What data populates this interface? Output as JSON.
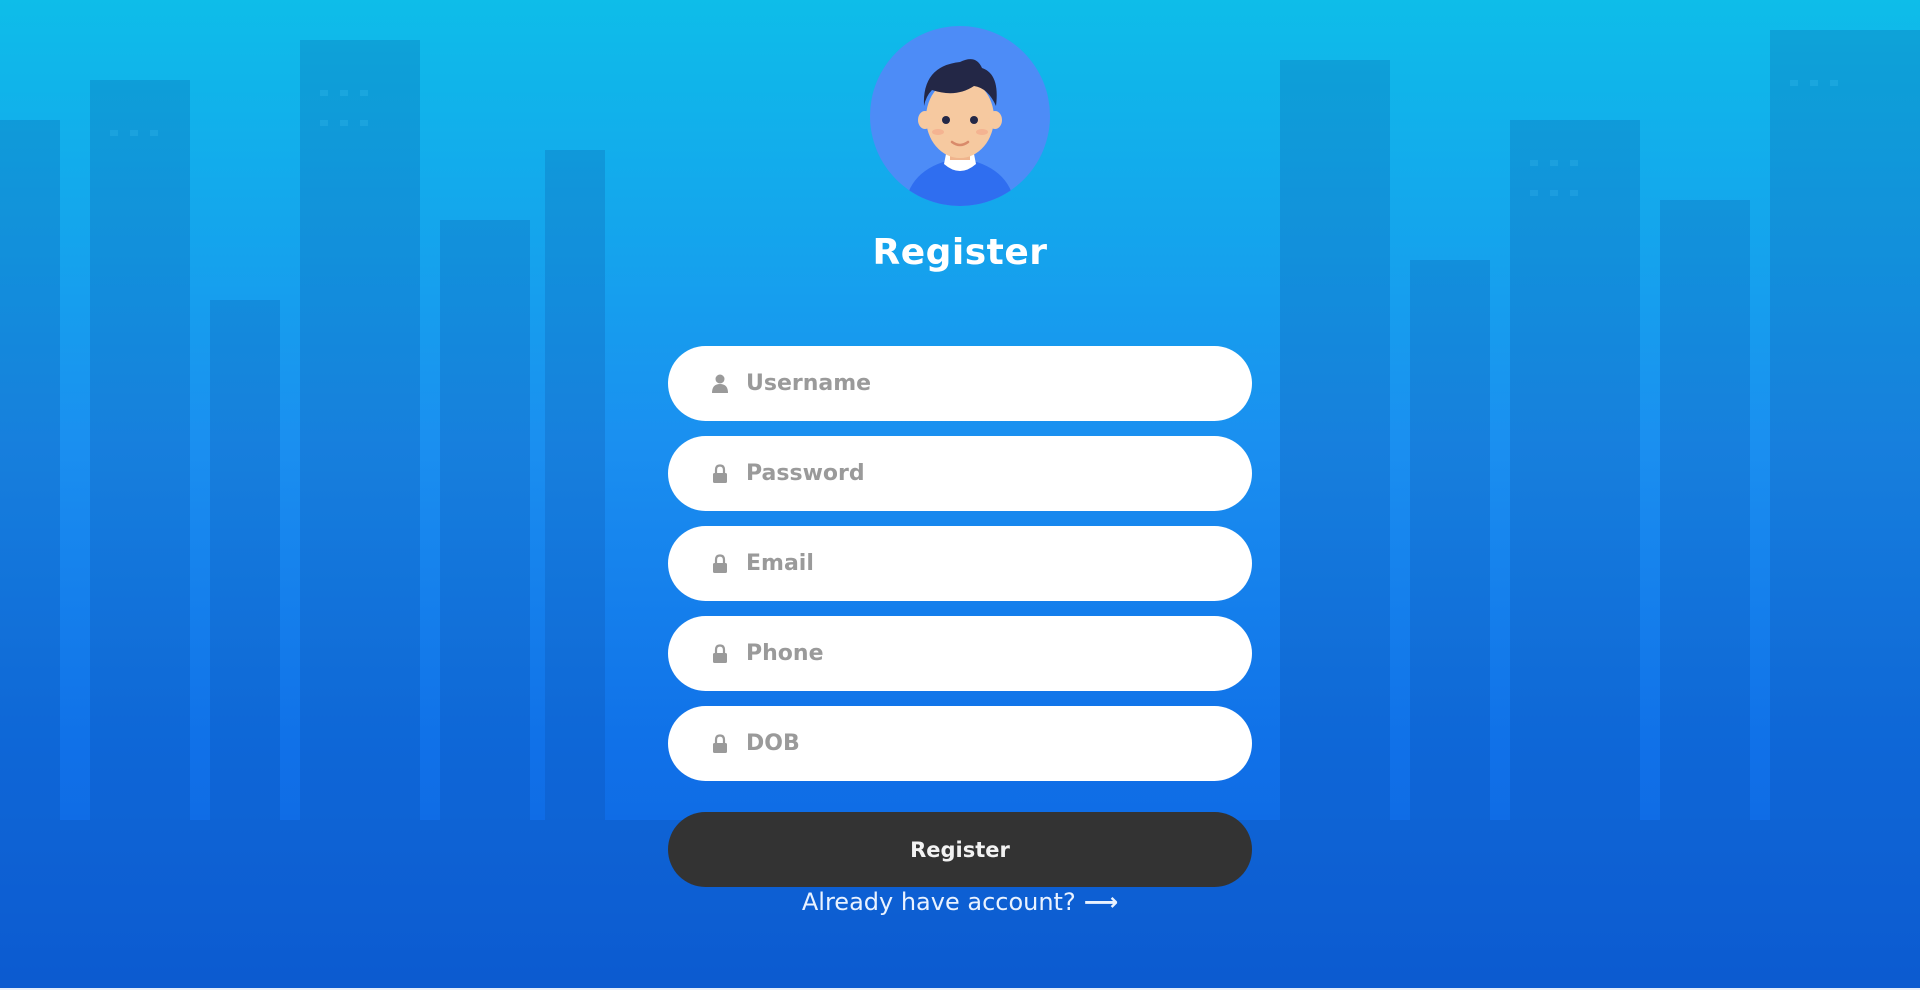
{
  "page": {
    "title": "Register"
  },
  "form": {
    "fields": [
      {
        "placeholder": "Username",
        "icon": "user-icon"
      },
      {
        "placeholder": "Password",
        "icon": "lock-icon"
      },
      {
        "placeholder": "Email",
        "icon": "lock-icon"
      },
      {
        "placeholder": "Phone",
        "icon": "lock-icon"
      },
      {
        "placeholder": "DOB",
        "icon": "lock-icon"
      }
    ],
    "submit_label": "Register",
    "login_link_text": "Already have account?",
    "login_link_arrow": "⟶"
  },
  "colors": {
    "background_top": "#0ebde9",
    "background_bottom": "#0d62e0",
    "field_bg": "#ffffff",
    "placeholder": "#9a9a9a",
    "button_bg": "#333333",
    "avatar_circle": "#4d8cf7"
  }
}
